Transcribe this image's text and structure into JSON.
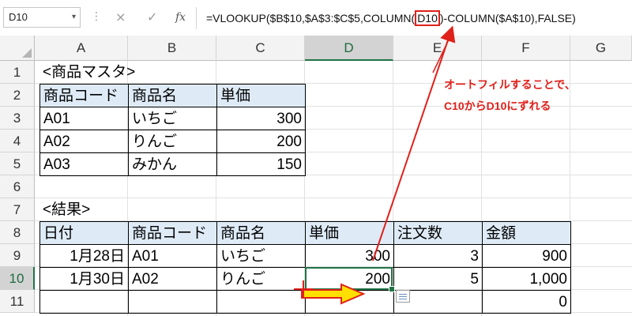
{
  "formula_bar": {
    "name_box": "D10",
    "cancel_icon": "×",
    "enter_icon": "✓",
    "fx_label": "fx",
    "formula_prefix": "=VLOOKUP($B$10,$A$3:$C$5,COLUMN(",
    "formula_highlight": "D10",
    "formula_suffix": ")-COLUMN($A$10),FALSE)"
  },
  "columns": [
    "A",
    "B",
    "C",
    "D",
    "E",
    "F",
    "G"
  ],
  "rows": [
    "1",
    "2",
    "3",
    "4",
    "5",
    "6",
    "7",
    "8",
    "9",
    "10",
    "11"
  ],
  "master": {
    "title": "<商品マスタ>",
    "headers": [
      "商品コード",
      "商品名",
      "単価"
    ],
    "rows": [
      [
        "A01",
        "いちご",
        "300"
      ],
      [
        "A02",
        "りんご",
        "200"
      ],
      [
        "A03",
        "みかん",
        "150"
      ]
    ]
  },
  "result": {
    "title": "<結果>",
    "headers": [
      "日付",
      "商品コード",
      "商品名",
      "単価",
      "注文数",
      "金額"
    ],
    "rows": [
      [
        "1月28日",
        "A01",
        "いちご",
        "300",
        "3",
        "900"
      ],
      [
        "1月30日",
        "A02",
        "りんご",
        "200",
        "5",
        "1,000"
      ],
      [
        "",
        "",
        "",
        "",
        "",
        "0"
      ]
    ]
  },
  "annotation": {
    "line1": "オートフィルすることで、",
    "line2": "C10からD10にずれる",
    "color": "#e0201a",
    "arrow_fill": "#ffe000"
  },
  "colors": {
    "header_fill": "#deebf7",
    "selection": "#217346"
  }
}
